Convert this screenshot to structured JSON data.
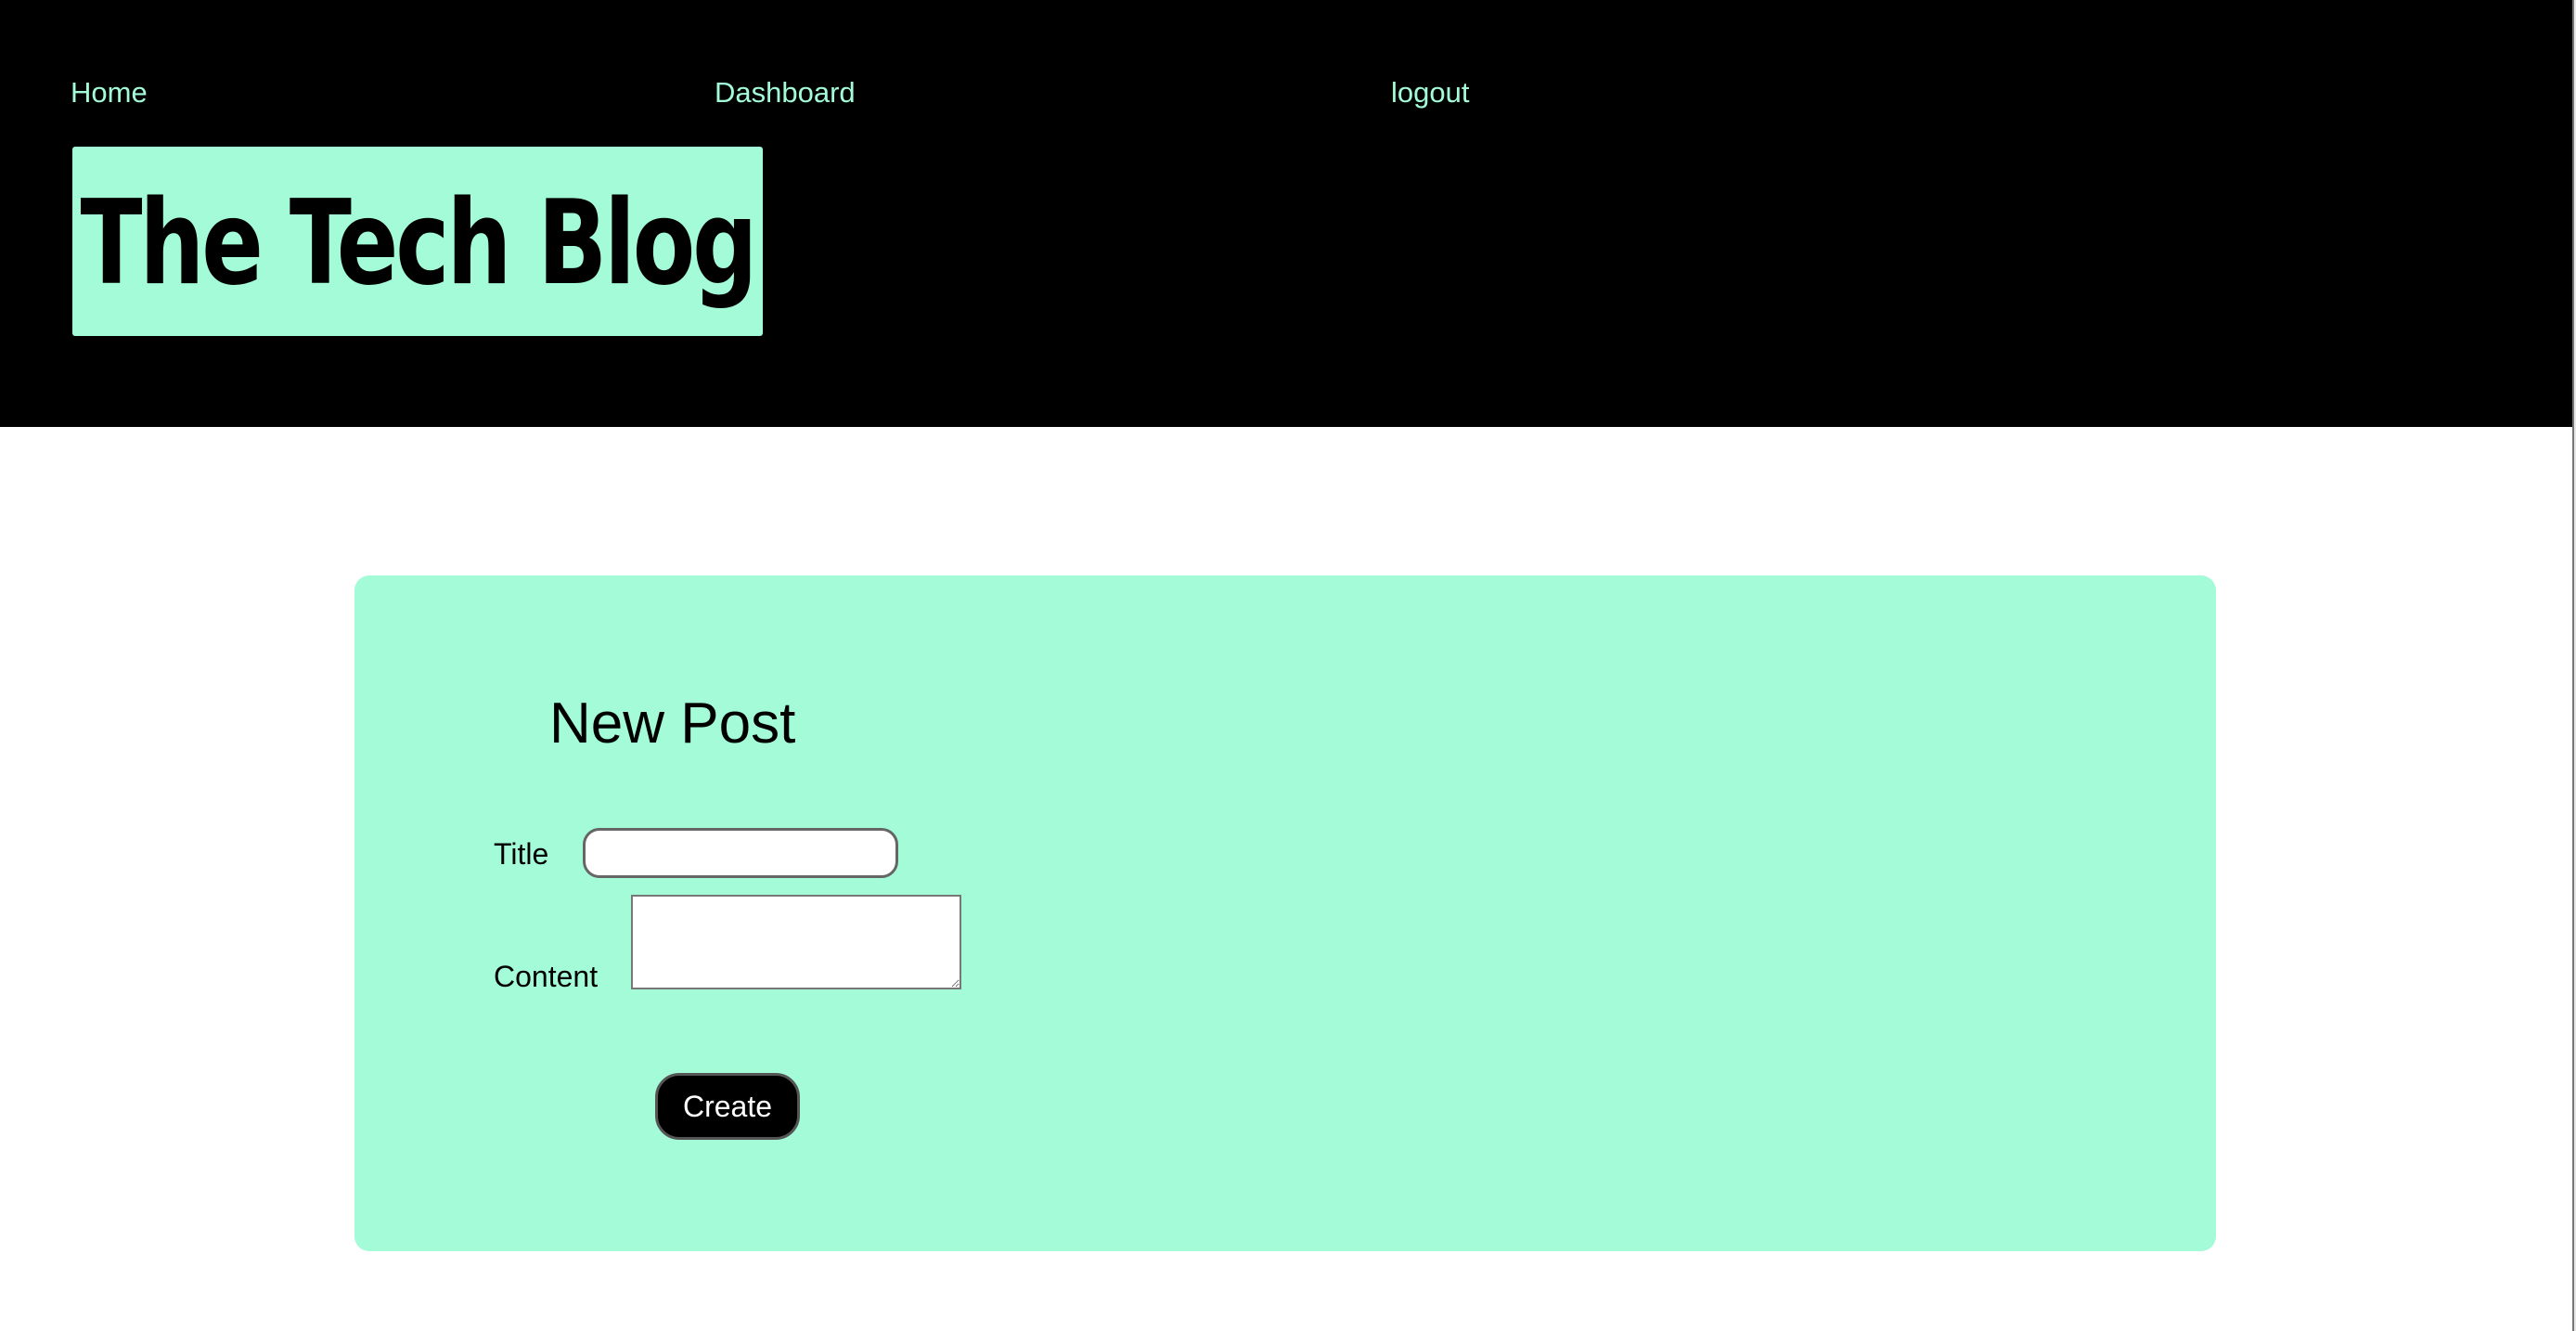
{
  "nav": {
    "home_label": "Home",
    "dashboard_label": "Dashboard",
    "logout_label": "logout"
  },
  "header": {
    "site_title": "The Tech Blog"
  },
  "new_post": {
    "heading": "New Post",
    "title_label": "Title",
    "title_value": "",
    "content_label": "Content",
    "content_value": "",
    "create_label": "Create"
  },
  "colors": {
    "header_background": "#000000",
    "accent_mint": "#a3fcd7",
    "page_background": "#ffffff",
    "button_background": "#000000",
    "button_text": "#ffffff"
  }
}
